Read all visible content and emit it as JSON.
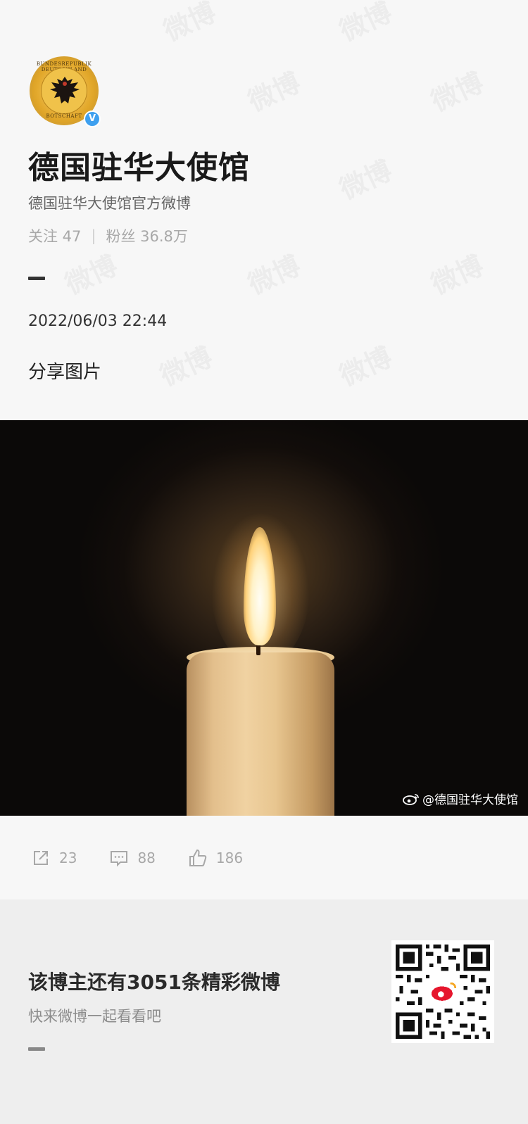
{
  "profile": {
    "avatar_ring_top": "BUNDESREPUBLIK DEUTSCHLAND",
    "avatar_ring_bottom": "BOTSCHAFT",
    "verified_badge": "V",
    "name": "德国驻华大使馆",
    "description": "德国驻华大使馆官方微博",
    "following_label": "关注 47",
    "separator": "|",
    "followers_label": "粉丝 36.8万"
  },
  "post": {
    "datetime": "2022/06/03 22:44",
    "text": "分享图片",
    "image_watermark": "@德国驻华大使馆"
  },
  "actions": {
    "repost_count": "23",
    "comment_count": "88",
    "like_count": "186"
  },
  "footer": {
    "title": "该博主还有3051条精彩微博",
    "subtitle": "快来微博一起看看吧"
  },
  "watermark_text": "微博",
  "colors": {
    "background": "#f7f7f7",
    "footer_background": "#eeeeee",
    "verified_blue": "#3ea0ef",
    "muted_text": "#a8a8a8"
  },
  "icons": [
    "verified-icon",
    "repost-icon",
    "comment-icon",
    "like-icon",
    "weibo-logo-icon",
    "qr-code"
  ]
}
